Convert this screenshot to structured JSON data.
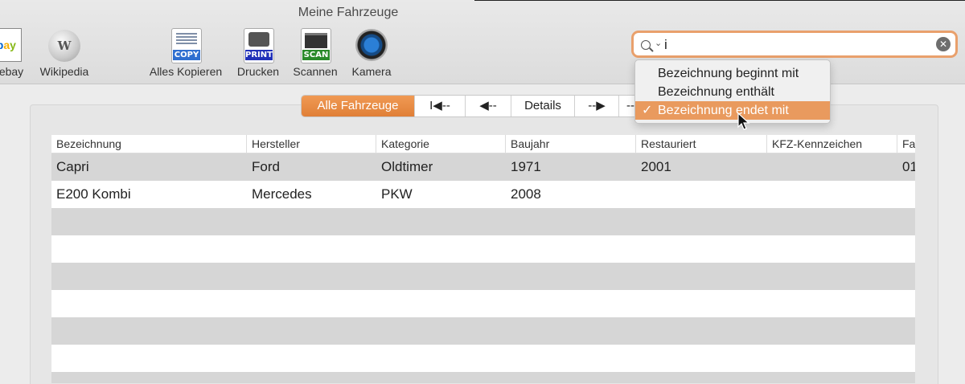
{
  "window": {
    "title": "Meine Fahrzeuge"
  },
  "toolbar": {
    "items": [
      {
        "label": "ebay",
        "icon": "ebay-icon"
      },
      {
        "label": "Wikipedia",
        "icon": "wikipedia-icon"
      },
      {
        "label": "Alles Kopieren",
        "icon": "copy-icon",
        "tag": "COPY"
      },
      {
        "label": "Drucken",
        "icon": "print-icon",
        "tag": "PRINT"
      },
      {
        "label": "Scannen",
        "icon": "scan-icon",
        "tag": "SCAN"
      },
      {
        "label": "Kamera",
        "icon": "camera-icon"
      }
    ]
  },
  "search": {
    "value": "i",
    "accent": "#e9a06c"
  },
  "search_menu": {
    "items": [
      {
        "label": "Bezeichnung beginnt mit",
        "selected": false
      },
      {
        "label": "Bezeichnung enthält",
        "selected": false
      },
      {
        "label": "Bezeichnung endet mit",
        "selected": true
      }
    ],
    "checkmark": "✓"
  },
  "segments": {
    "all": "Alle Fahrzeuge",
    "first": "I◀--",
    "prev": "◀--",
    "details": "Details",
    "next": "--▶",
    "last": "--"
  },
  "table": {
    "columns": [
      "Bezeichnung",
      "Hersteller",
      "Kategorie",
      "Baujahr",
      "Restauriert",
      "KFZ-Kennzeichen",
      "Fa"
    ],
    "rows": [
      [
        "Capri",
        "Ford",
        "Oldtimer",
        "1971",
        "2001",
        "",
        "01"
      ],
      [
        "E200 Kombi",
        "Mercedes",
        "PKW",
        "2008",
        "",
        "",
        ""
      ]
    ]
  },
  "colors": {
    "accent": "#e07f37",
    "row_alt": "#d6d6d6"
  }
}
